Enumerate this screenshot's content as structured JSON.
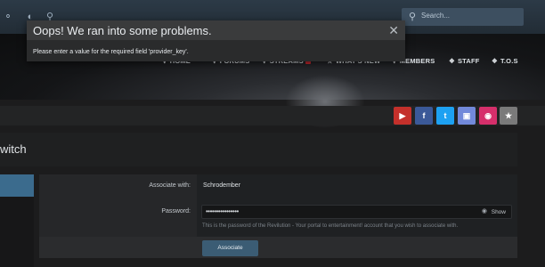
{
  "search": {
    "placeholder": "Search..."
  },
  "nav": {
    "items": [
      {
        "label": "HOME",
        "icon": "home-icon"
      },
      {
        "label": "FORUMS",
        "icon": "forums-icon"
      },
      {
        "label": "STREAMS",
        "icon": "streams-icon"
      },
      {
        "label": "WHAT'S NEW",
        "icon": "star-icon"
      },
      {
        "label": "MEMBERS",
        "icon": "members-icon"
      },
      {
        "label": "STAFF",
        "icon": "tag-icon"
      },
      {
        "label": "T.O.S",
        "icon": "tag-icon"
      }
    ]
  },
  "error": {
    "title": "Oops! We ran into some problems.",
    "message": "Please enter a value for the required field 'provider_key'."
  },
  "social": {
    "colors": {
      "youtube": "#c4302b",
      "facebook": "#3b5998",
      "twitter": "#1da1f2",
      "discord": "#7289da",
      "instagram": "#d62f6b",
      "favorite": "#7a7a7a"
    }
  },
  "page": {
    "title": "witch"
  },
  "form": {
    "associate_label": "Associate with:",
    "associate_value": "Schrodember",
    "password_label": "Password:",
    "password_value": "••••••••••••••••",
    "show_label": "Show",
    "hint": "This is the password of the Revilution - Your portal to entertainment! account that you wish to associate with.",
    "button_label": "Associate"
  }
}
